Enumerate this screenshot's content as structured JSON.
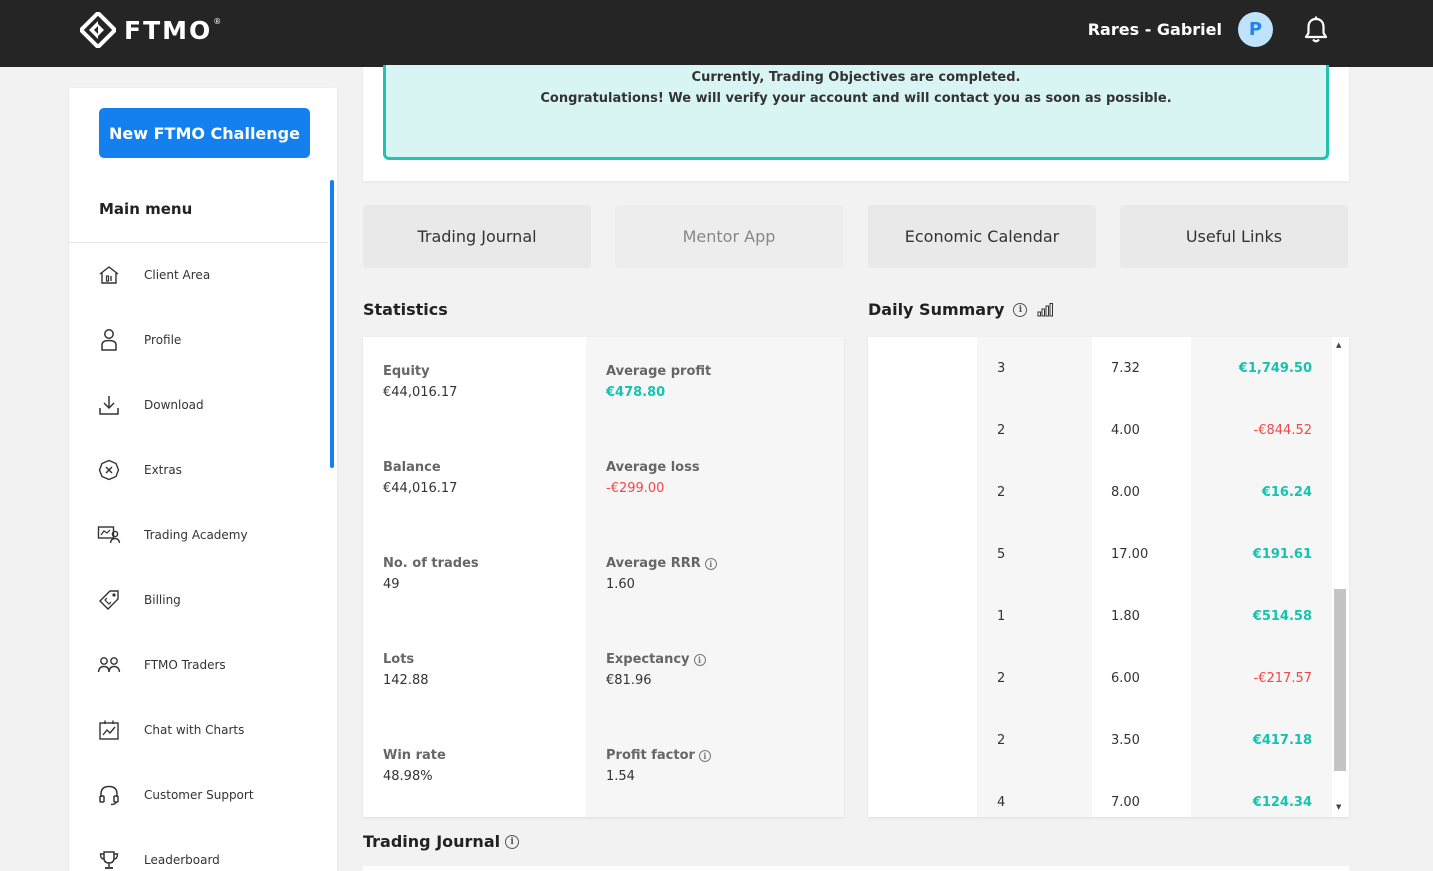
{
  "header": {
    "logo_text": "FTMO",
    "logo_reg": "®",
    "username": "Rares - Gabriel",
    "avatar_letter": "P"
  },
  "sidebar": {
    "new_challenge_label": "New FTMO Challenge",
    "menu_title": "Main menu",
    "items": [
      {
        "label": "Client Area",
        "icon": "home-icon"
      },
      {
        "label": "Profile",
        "icon": "user-icon"
      },
      {
        "label": "Download",
        "icon": "download-icon"
      },
      {
        "label": "Extras",
        "icon": "extras-icon"
      },
      {
        "label": "Trading Academy",
        "icon": "academy-icon"
      },
      {
        "label": "Billing",
        "icon": "billing-tag-icon"
      },
      {
        "label": "FTMO Traders",
        "icon": "users-icon"
      },
      {
        "label": "Chat with Charts",
        "icon": "chart-chat-icon"
      },
      {
        "label": "Customer Support",
        "icon": "headset-icon"
      },
      {
        "label": "Leaderboard",
        "icon": "trophy-icon"
      }
    ]
  },
  "notice": {
    "line1": "Currently, Trading Objectives are completed.",
    "line2": "Congratulations! We will verify your account and will contact you as soon as possible."
  },
  "tabs": [
    {
      "label": "Trading Journal",
      "disabled": false
    },
    {
      "label": "Mentor App",
      "disabled": true
    },
    {
      "label": "Economic Calendar",
      "disabled": false
    },
    {
      "label": "Useful Links",
      "disabled": false
    }
  ],
  "statistics": {
    "title": "Statistics",
    "rows": [
      {
        "left_label": "Equity",
        "left_value": "€44,016.17",
        "right_label": "Average profit",
        "right_value": "€478.80",
        "right_tone": "pos",
        "right_info": false
      },
      {
        "left_label": "Balance",
        "left_value": "€44,016.17",
        "right_label": "Average loss",
        "right_value": "-€299.00",
        "right_tone": "neg",
        "right_info": false
      },
      {
        "left_label": "No. of trades",
        "left_value": "49",
        "right_label": "Average RRR",
        "right_value": "1.60",
        "right_tone": "",
        "right_info": true
      },
      {
        "left_label": "Lots",
        "left_value": "142.88",
        "right_label": "Expectancy",
        "right_value": "€81.96",
        "right_tone": "",
        "right_info": true
      },
      {
        "left_label": "Win rate",
        "left_value": "48.98%",
        "right_label": "Profit factor",
        "right_value": "1.54",
        "right_tone": "",
        "right_info": true
      }
    ]
  },
  "daily_summary": {
    "title": "Daily Summary",
    "rows": [
      {
        "trades": "3",
        "lots": "7.32",
        "result": "€1,749.50",
        "tone": "pos"
      },
      {
        "trades": "2",
        "lots": "4.00",
        "result": "-€844.52",
        "tone": "neg"
      },
      {
        "trades": "2",
        "lots": "8.00",
        "result": "€16.24",
        "tone": "pos"
      },
      {
        "trades": "5",
        "lots": "17.00",
        "result": "€191.61",
        "tone": "pos"
      },
      {
        "trades": "1",
        "lots": "1.80",
        "result": "€514.58",
        "tone": "pos"
      },
      {
        "trades": "2",
        "lots": "6.00",
        "result": "-€217.57",
        "tone": "neg"
      },
      {
        "trades": "2",
        "lots": "3.50",
        "result": "€417.18",
        "tone": "pos"
      },
      {
        "trades": "4",
        "lots": "7.00",
        "result": "€124.34",
        "tone": "pos"
      }
    ]
  },
  "journal_section": {
    "title": "Trading Journal"
  },
  "colors": {
    "accent": "#1480f0",
    "positive": "#16c2b0",
    "negative": "#f04848",
    "notice_bg": "#d8f5f4",
    "notice_border": "#22c3ad"
  }
}
